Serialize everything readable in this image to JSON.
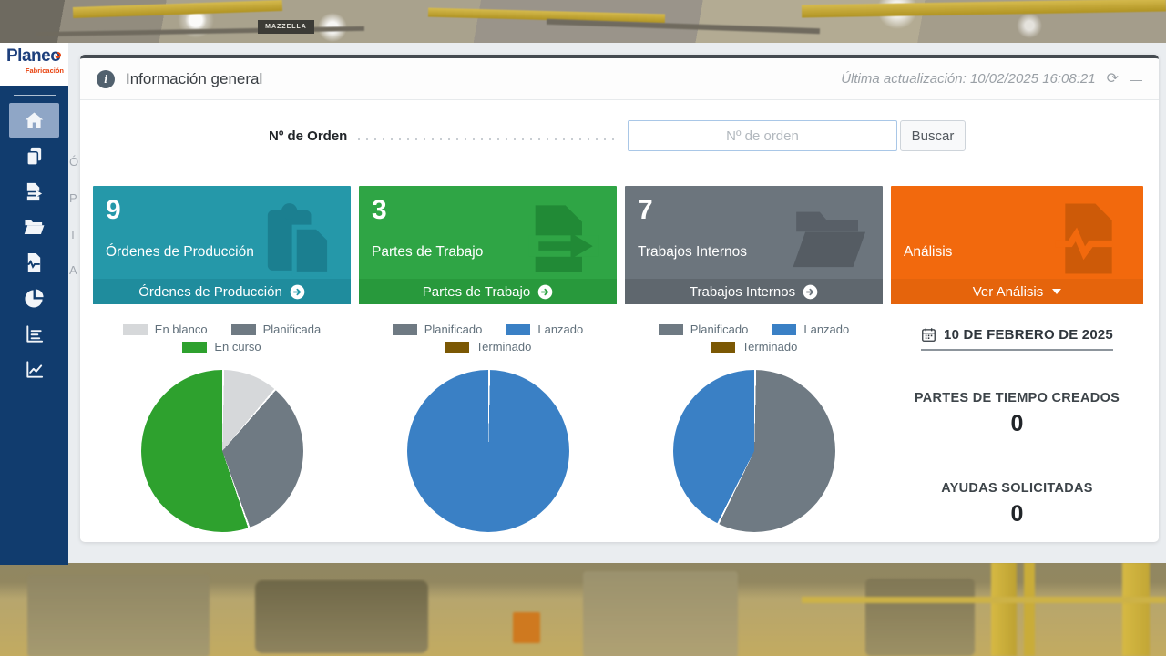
{
  "app": {
    "logo_primary": "Planeo",
    "logo_secondary": "Fabricación"
  },
  "background": {
    "sign": "MAZZELLA"
  },
  "sidebar": {
    "items": [
      {
        "name": "home",
        "active": true
      },
      {
        "name": "production-orders"
      },
      {
        "name": "work-reports"
      },
      {
        "name": "internal-jobs"
      },
      {
        "name": "analysis-doc"
      },
      {
        "name": "pie-chart"
      },
      {
        "name": "bar-chart"
      },
      {
        "name": "line-chart"
      }
    ],
    "peek": [
      "Ó",
      "P",
      "T",
      "A"
    ]
  },
  "header": {
    "title": "Información general",
    "info_glyph": "i",
    "last_update_label": "Última actualización:",
    "last_update_value": "10/02/2025 16:08:21",
    "refresh_glyph": "⟳",
    "minimize_glyph": "—"
  },
  "search": {
    "label": "Nº de Orden",
    "placeholder": "Nº de orden",
    "value": "",
    "button": "Buscar"
  },
  "cards": [
    {
      "count": "9",
      "label": "Órdenes de Producción",
      "footer": "Órdenes de Producción",
      "icon": "clipboard-copy-icon",
      "color": "#2598a9",
      "color_dark": "#1b7f90",
      "footer_color": "#1f8c9d"
    },
    {
      "count": "3",
      "label": "Partes de Trabajo",
      "footer": "Partes de Trabajo",
      "icon": "file-export-icon",
      "color": "#2fa545",
      "color_dark": "#218a36",
      "footer_color": "#28993c"
    },
    {
      "count": "7",
      "label": "Trabajos Internos",
      "footer": "Trabajos Internos",
      "icon": "folder-open-icon",
      "color": "#6c757d",
      "color_dark": "#555c63",
      "footer_color": "#5f676e"
    },
    {
      "count": "",
      "label": "Análisis",
      "footer": "Ver Análisis",
      "icon": "file-waveform-icon",
      "color": "#f2690d",
      "color_dark": "#cd5a08",
      "footer_color": "#e5640c"
    }
  ],
  "chart_data": [
    {
      "type": "pie",
      "title": "Órdenes de Producción",
      "labels": [
        "En blanco",
        "Planificada",
        "En curso"
      ],
      "values": [
        1,
        3,
        5
      ],
      "colors": [
        "#d6d8da",
        "#6f7a83",
        "#2ea12e"
      ],
      "legend_position": "top"
    },
    {
      "type": "pie",
      "title": "Partes de Trabajo",
      "labels": [
        "Planificado",
        "Lanzado",
        "Terminado"
      ],
      "values": [
        0,
        3,
        0
      ],
      "colors": [
        "#6f7a83",
        "#3a80c5",
        "#7b5804"
      ],
      "legend_position": "top"
    },
    {
      "type": "pie",
      "title": "Trabajos Internos",
      "labels": [
        "Planificado",
        "Lanzado",
        "Terminado"
      ],
      "values": [
        4,
        3,
        0
      ],
      "colors": [
        "#6f7a83",
        "#3a80c5",
        "#7b5804"
      ],
      "legend_position": "top"
    }
  ],
  "stats": {
    "date": "10 DE FEBRERO DE 2025",
    "items": [
      {
        "label": "PARTES DE TIEMPO CREADOS",
        "value": "0"
      },
      {
        "label": "AYUDAS SOLICITADAS",
        "value": "0"
      }
    ]
  }
}
